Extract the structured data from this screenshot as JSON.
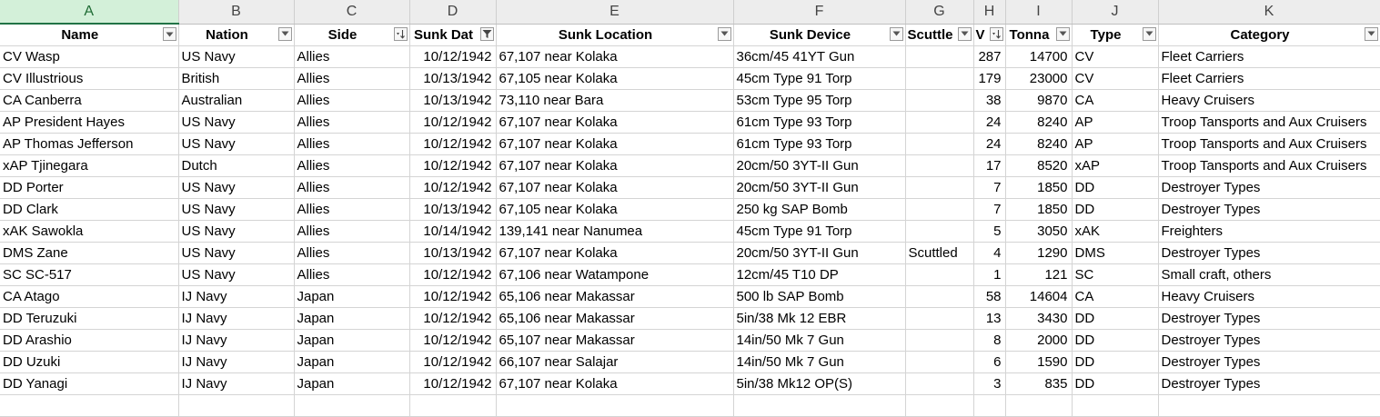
{
  "column_letters": [
    "A",
    "B",
    "C",
    "D",
    "E",
    "F",
    "G",
    "H",
    "I",
    "J",
    "K"
  ],
  "selected_column": "A",
  "headers": [
    {
      "label": "Name",
      "filter_icon": "dropdown-arrow-icon"
    },
    {
      "label": "Nation",
      "filter_icon": "dropdown-arrow-icon"
    },
    {
      "label": "Side",
      "filter_icon": "sort-descending-icon"
    },
    {
      "label": "Sunk Dat",
      "filter_icon": "filter-funnel-icon"
    },
    {
      "label": "Sunk Location",
      "filter_icon": "dropdown-arrow-icon"
    },
    {
      "label": "Sunk Device",
      "filter_icon": "dropdown-arrow-icon"
    },
    {
      "label": "Scuttle",
      "filter_icon": "dropdown-arrow-icon"
    },
    {
      "label": "V",
      "filter_icon": "sort-descending-icon"
    },
    {
      "label": "Tonna",
      "filter_icon": "dropdown-arrow-icon"
    },
    {
      "label": "Type",
      "filter_icon": "dropdown-arrow-icon"
    },
    {
      "label": "Category",
      "filter_icon": "dropdown-arrow-icon"
    }
  ],
  "rows": [
    [
      "CV Wasp",
      "US Navy",
      "Allies",
      "10/12/1942",
      "67,107 near Kolaka",
      "36cm/45 41YT Gun",
      "",
      "287",
      "14700",
      "CV",
      "Fleet Carriers"
    ],
    [
      "CV Illustrious",
      "British",
      "Allies",
      "10/13/1942",
      "67,105 near Kolaka",
      "45cm Type 91 Torp",
      "",
      "179",
      "23000",
      "CV",
      "Fleet Carriers"
    ],
    [
      "CA Canberra",
      "Australian",
      "Allies",
      "10/13/1942",
      "73,110 near Bara",
      "53cm Type 95 Torp",
      "",
      "38",
      "9870",
      "CA",
      "Heavy Cruisers"
    ],
    [
      "AP President Hayes",
      "US Navy",
      "Allies",
      "10/12/1942",
      "67,107 near Kolaka",
      "61cm Type 93 Torp",
      "",
      "24",
      "8240",
      "AP",
      "Troop Tansports and Aux Cruisers"
    ],
    [
      "AP Thomas Jefferson",
      "US Navy",
      "Allies",
      "10/12/1942",
      "67,107 near Kolaka",
      "61cm Type 93 Torp",
      "",
      "24",
      "8240",
      "AP",
      "Troop Tansports and Aux Cruisers"
    ],
    [
      "xAP Tjinegara",
      "Dutch",
      "Allies",
      "10/12/1942",
      "67,107 near Kolaka",
      "20cm/50 3YT-II Gun",
      "",
      "17",
      "8520",
      "xAP",
      "Troop Tansports and Aux Cruisers"
    ],
    [
      "DD Porter",
      "US Navy",
      "Allies",
      "10/12/1942",
      "67,107 near Kolaka",
      "20cm/50 3YT-II Gun",
      "",
      "7",
      "1850",
      "DD",
      "Destroyer Types"
    ],
    [
      "DD Clark",
      "US Navy",
      "Allies",
      "10/13/1942",
      "67,105 near Kolaka",
      "250 kg SAP Bomb",
      "",
      "7",
      "1850",
      "DD",
      "Destroyer Types"
    ],
    [
      "xAK Sawokla",
      "US Navy",
      "Allies",
      "10/14/1942",
      "139,141 near Nanumea",
      "45cm Type 91 Torp",
      "",
      "5",
      "3050",
      "xAK",
      "Freighters"
    ],
    [
      "DMS Zane",
      "US Navy",
      "Allies",
      "10/13/1942",
      "67,107 near Kolaka",
      "20cm/50 3YT-II Gun",
      "Scuttled",
      "4",
      "1290",
      "DMS",
      "Destroyer Types"
    ],
    [
      "SC SC-517",
      "US Navy",
      "Allies",
      "10/12/1942",
      "67,106 near Watampone",
      "12cm/45 T10 DP",
      "",
      "1",
      "121",
      "SC",
      "Small craft, others"
    ],
    [
      "CA Atago",
      "IJ Navy",
      "Japan",
      "10/12/1942",
      "65,106 near Makassar",
      "500 lb SAP Bomb",
      "",
      "58",
      "14604",
      "CA",
      "Heavy Cruisers"
    ],
    [
      "DD Teruzuki",
      "IJ Navy",
      "Japan",
      "10/12/1942",
      "65,106 near Makassar",
      "5in/38 Mk 12 EBR",
      "",
      "13",
      "3430",
      "DD",
      "Destroyer Types"
    ],
    [
      "DD Arashio",
      "IJ Navy",
      "Japan",
      "10/12/1942",
      "65,107 near Makassar",
      "14in/50 Mk 7 Gun",
      "",
      "8",
      "2000",
      "DD",
      "Destroyer Types"
    ],
    [
      "DD Uzuki",
      "IJ Navy",
      "Japan",
      "10/12/1942",
      "66,107 near Salajar",
      "14in/50 Mk 7 Gun",
      "",
      "6",
      "1590",
      "DD",
      "Destroyer Types"
    ],
    [
      "DD Yanagi",
      "IJ Navy",
      "Japan",
      "10/12/1942",
      "67,107 near Kolaka",
      "5in/38 Mk12 OP(S)",
      "",
      "3",
      "835",
      "DD",
      "Destroyer Types"
    ]
  ],
  "colors": {
    "selected_header": "#d3f0d9",
    "selected_border": "#217346",
    "gridline": "#d4d4d4"
  }
}
